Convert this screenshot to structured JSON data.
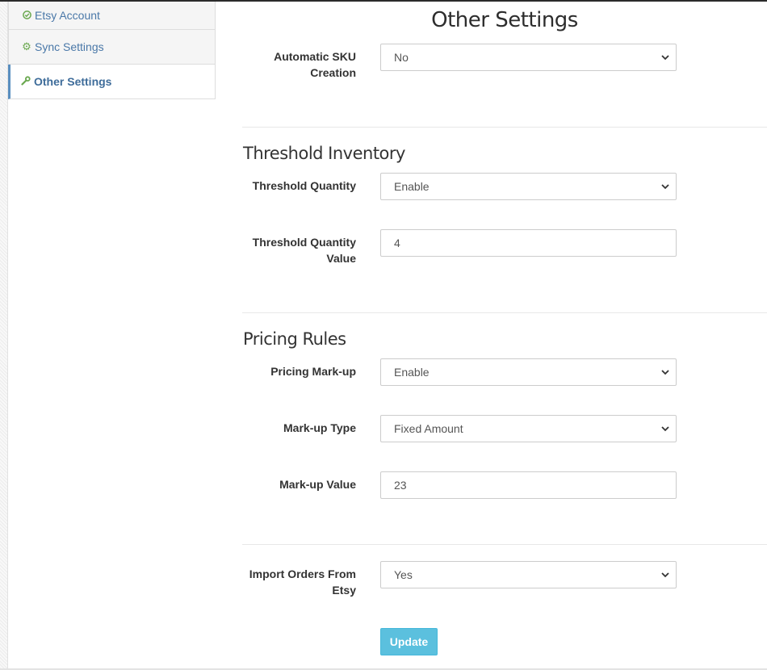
{
  "sidebar": {
    "items": [
      {
        "label": "Etsy Account",
        "icon": "check-circle-icon"
      },
      {
        "label": "Sync Settings",
        "icon": "gear-icon"
      },
      {
        "label": "Other Settings",
        "icon": "wrench-icon",
        "active": true
      }
    ]
  },
  "page": {
    "title": "Other Settings"
  },
  "sku": {
    "label_line1": "Automatic SKU",
    "label_line2": "Creation",
    "value": "No"
  },
  "threshold": {
    "title": "Threshold Inventory",
    "quantity_label": "Threshold Quantity",
    "quantity_value": "Enable",
    "value_label_line1": "Threshold Quantity",
    "value_label_line2": "Value",
    "value": "4"
  },
  "pricing": {
    "title": "Pricing Rules",
    "markup_label": "Pricing Mark-up",
    "markup_value": "Enable",
    "type_label": "Mark-up Type",
    "type_value": "Fixed Amount",
    "value_label": "Mark-up Value",
    "value": "23"
  },
  "orders": {
    "label_line1": "Import Orders From",
    "label_line2": "Etsy",
    "value": "Yes"
  },
  "actions": {
    "update_label": "Update"
  },
  "colors": {
    "accent": "#5bc0de",
    "link": "#4a78a8",
    "icon_green": "#6aa84f"
  }
}
